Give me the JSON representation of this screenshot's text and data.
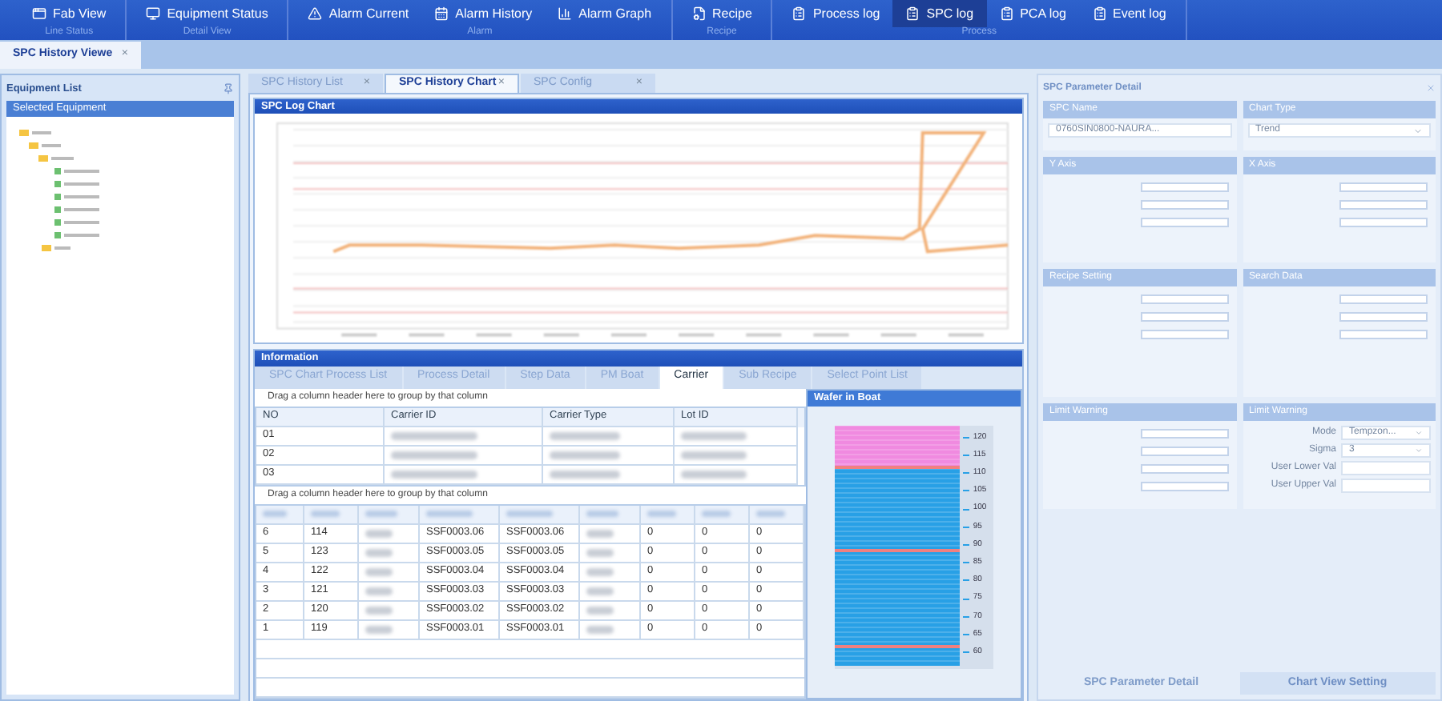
{
  "toolbar": {
    "groups": [
      {
        "label": "Line Status",
        "items": [
          {
            "label": "Fab View",
            "selected": false
          }
        ]
      },
      {
        "label": "Detail View",
        "items": [
          {
            "label": "Equipment Status",
            "selected": false
          }
        ]
      },
      {
        "label": "Alarm",
        "items": [
          {
            "label": "Alarm Current",
            "selected": false
          },
          {
            "label": "Alarm History",
            "selected": false
          },
          {
            "label": "Alarm Graph",
            "selected": false
          }
        ]
      },
      {
        "label": "Recipe",
        "items": [
          {
            "label": "Recipe",
            "selected": false
          }
        ]
      },
      {
        "label": "Process",
        "items": [
          {
            "label": "Process log",
            "selected": false
          },
          {
            "label": "SPC log",
            "selected": true
          },
          {
            "label": "PCA log",
            "selected": false
          },
          {
            "label": "Event log",
            "selected": false
          }
        ]
      }
    ]
  },
  "document_tabs": [
    {
      "label": "SPC History Viewe",
      "close": "×",
      "selected": true
    }
  ],
  "equipment_panel": {
    "title": "Equipment List",
    "subtitle": "Selected Equipment"
  },
  "center_tabs": [
    {
      "label": "SPC History List",
      "close": "×",
      "selected": false
    },
    {
      "label": "SPC History Chart",
      "close": "×",
      "selected": true
    },
    {
      "label": "SPC Config",
      "close": "×",
      "selected": false
    }
  ],
  "chart_panel": {
    "title": "SPC Log Chart"
  },
  "information": {
    "title": "Information",
    "tabs": [
      {
        "label": "SPC Chart Process List",
        "selected": false
      },
      {
        "label": "Process Detail",
        "selected": false
      },
      {
        "label": "Step Data",
        "selected": false
      },
      {
        "label": "PM Boat",
        "selected": false
      },
      {
        "label": "Carrier",
        "selected": true
      },
      {
        "label": "Sub Recipe",
        "selected": false
      },
      {
        "label": "Select Point List",
        "selected": false
      }
    ],
    "carrier_table": {
      "group_hint": "Drag a column header here to group by that column",
      "columns": [
        "NO",
        "Carrier ID",
        "Carrier Type",
        "Lot ID"
      ],
      "rows": [
        [
          {
            "kind": "text",
            "text": "01"
          },
          {
            "kind": "blurred"
          },
          {
            "kind": "blurred"
          },
          {
            "kind": "blurred"
          }
        ],
        [
          {
            "kind": "text",
            "text": "02"
          },
          {
            "kind": "blurred"
          },
          {
            "kind": "blurred"
          },
          {
            "kind": "blurred"
          }
        ],
        [
          {
            "kind": "text",
            "text": "03"
          },
          {
            "kind": "blurred"
          },
          {
            "kind": "blurred"
          },
          {
            "kind": "blurred"
          }
        ]
      ]
    },
    "wafer_table": {
      "group_hint": "Drag a column header here to group by that column",
      "rows": [
        [
          {
            "kind": "text",
            "text": "6"
          },
          {
            "kind": "text",
            "text": "114"
          },
          {
            "kind": "blurred"
          },
          {
            "kind": "text",
            "text": "SSF0003.06"
          },
          {
            "kind": "text",
            "text": "SSF0003.06"
          },
          {
            "kind": "blurred"
          },
          {
            "kind": "text",
            "text": "0"
          },
          {
            "kind": "text",
            "text": "0"
          },
          {
            "kind": "text",
            "text": "0"
          }
        ],
        [
          {
            "kind": "text",
            "text": "5"
          },
          {
            "kind": "text",
            "text": "123"
          },
          {
            "kind": "blurred"
          },
          {
            "kind": "text",
            "text": "SSF0003.05"
          },
          {
            "kind": "text",
            "text": "SSF0003.05"
          },
          {
            "kind": "blurred"
          },
          {
            "kind": "text",
            "text": "0"
          },
          {
            "kind": "text",
            "text": "0"
          },
          {
            "kind": "text",
            "text": "0"
          }
        ],
        [
          {
            "kind": "text",
            "text": "4"
          },
          {
            "kind": "text",
            "text": "122"
          },
          {
            "kind": "blurred"
          },
          {
            "kind": "text",
            "text": "SSF0003.04"
          },
          {
            "kind": "text",
            "text": "SSF0003.04"
          },
          {
            "kind": "blurred"
          },
          {
            "kind": "text",
            "text": "0"
          },
          {
            "kind": "text",
            "text": "0"
          },
          {
            "kind": "text",
            "text": "0"
          }
        ],
        [
          {
            "kind": "text",
            "text": "3"
          },
          {
            "kind": "text",
            "text": "121"
          },
          {
            "kind": "blurred"
          },
          {
            "kind": "text",
            "text": "SSF0003.03"
          },
          {
            "kind": "text",
            "text": "SSF0003.03"
          },
          {
            "kind": "blurred"
          },
          {
            "kind": "text",
            "text": "0"
          },
          {
            "kind": "text",
            "text": "0"
          },
          {
            "kind": "text",
            "text": "0"
          }
        ],
        [
          {
            "kind": "text",
            "text": "2"
          },
          {
            "kind": "text",
            "text": "120"
          },
          {
            "kind": "blurred"
          },
          {
            "kind": "text",
            "text": "SSF0003.02"
          },
          {
            "kind": "text",
            "text": "SSF0003.02"
          },
          {
            "kind": "blurred"
          },
          {
            "kind": "text",
            "text": "0"
          },
          {
            "kind": "text",
            "text": "0"
          },
          {
            "kind": "text",
            "text": "0"
          }
        ],
        [
          {
            "kind": "text",
            "text": "1"
          },
          {
            "kind": "text",
            "text": "119"
          },
          {
            "kind": "blurred"
          },
          {
            "kind": "text",
            "text": "SSF0003.01"
          },
          {
            "kind": "text",
            "text": "SSF0003.01"
          },
          {
            "kind": "blurred"
          },
          {
            "kind": "text",
            "text": "0"
          },
          {
            "kind": "text",
            "text": "0"
          },
          {
            "kind": "text",
            "text": "0"
          }
        ]
      ]
    },
    "wafer_boat": {
      "title": "Wafer in Boat",
      "scale": [
        "120",
        "115",
        "110",
        "105",
        "100",
        "95",
        "90",
        "85",
        "80",
        "75",
        "70",
        "65",
        "60"
      ]
    }
  },
  "parameter_panel": {
    "title": "SPC Parameter Detail",
    "spc_name": {
      "label": "SPC Name",
      "value": "0760SIN0800-NAURA..."
    },
    "chart_type": {
      "label": "Chart Type",
      "value": "Trend"
    },
    "sections": [
      {
        "title": "Y Axis"
      },
      {
        "title": "X Axis"
      },
      {
        "title": "Recipe Setting"
      },
      {
        "title": "Search Data"
      },
      {
        "title": "Limit Warning"
      }
    ],
    "limit_warning": {
      "title": "Limit Warning",
      "fields": [
        {
          "kind": "select",
          "label": "Mode",
          "value": "Tempzon..."
        },
        {
          "kind": "select",
          "label": "Sigma",
          "value": "3"
        },
        {
          "kind": "input",
          "label": "User Lower Val"
        },
        {
          "kind": "input",
          "label": "User Upper Val"
        }
      ]
    },
    "bottom_tabs": [
      {
        "label": "SPC Parameter Detail",
        "selected": true
      },
      {
        "label": "Chart View Setting",
        "selected": false
      }
    ]
  }
}
